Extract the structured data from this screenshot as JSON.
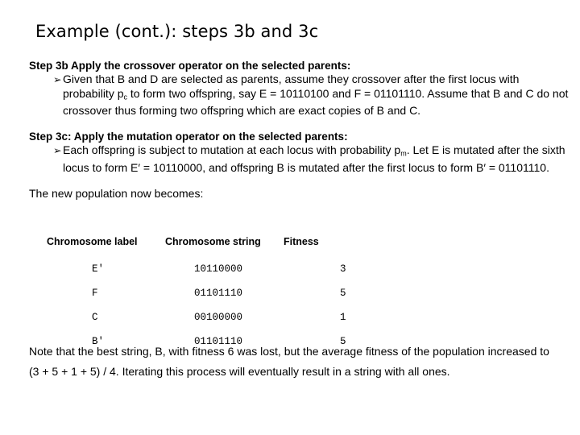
{
  "slide": {
    "title": "Example (cont.): steps 3b and 3c",
    "step3b": {
      "heading": "Step 3b  Apply the crossover operator on the selected parents:",
      "bullet_glyph": "➢",
      "text_part1": "Given that B and D are selected as parents, assume they crossover after the first locus with probability p",
      "subscript1": "c",
      "text_part2": " to form two offspring, say E = 10110100 and F = 01101110. Assume that B and C do not crossover thus forming two offspring which are exact copies of B and C."
    },
    "step3c": {
      "heading": "Step 3c: Apply the mutation operator on the selected parents:",
      "bullet_glyph": "➢",
      "text_part1": "Each offspring is subject to mutation at each locus with probability p",
      "subscript1": "m",
      "text_part2": ". Let E is mutated after the sixth locus to form E′ = 10110000, and offspring B is mutated after the first locus to form B′ = 01101110."
    },
    "lead_line": "The new population now becomes:",
    "table": {
      "headers": [
        "Chromosome label",
        "Chromosome string",
        "Fitness"
      ],
      "rows": [
        {
          "label": "E′",
          "string": "10110000",
          "fitness": "3"
        },
        {
          "label": "F",
          "string": "01101110",
          "fitness": "5"
        },
        {
          "label": "C",
          "string": "00100000",
          "fitness": "1"
        },
        {
          "label": "B′",
          "string": "01101110",
          "fitness": "5"
        }
      ]
    },
    "closing": "Note that the best string, B, with fitness 6 was lost, but the average fitness of the population increased to (3 + 5 + 1 + 5) / 4. Iterating this process will eventually result in a string with all ones."
  }
}
